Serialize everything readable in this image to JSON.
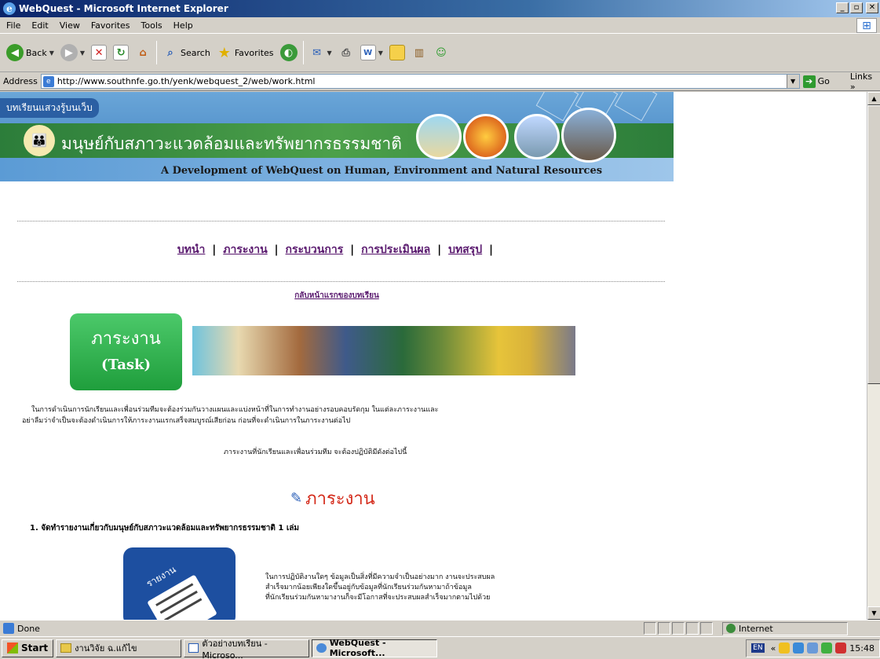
{
  "window": {
    "title": "WebQuest - Microsoft Internet Explorer",
    "buttons": [
      "_",
      "▫",
      "✕"
    ]
  },
  "menu": [
    "File",
    "Edit",
    "View",
    "Favorites",
    "Tools",
    "Help"
  ],
  "toolbar": {
    "back_label": "Back",
    "search_label": "Search",
    "favorites_label": "Favorites"
  },
  "address": {
    "label": "Address",
    "url": "http://www.southnfe.go.th/yenk/webquest_2/web/work.html",
    "go_label": "Go",
    "links_label": "Links »"
  },
  "banner": {
    "tagline": "บทเรียนแสวงรู้บนเว็บ",
    "thai_title": "มนุษย์กับสภาวะแวดล้อมและทรัพยากรธรรมชาติ",
    "english_title": "A Development of WebQuest on Human, Environment and Natural Resources"
  },
  "nav": {
    "links": [
      "บทนำ",
      "ภาระงาน",
      "กระบวนการ",
      "การประเมินผล",
      "บทสรุป"
    ],
    "separator": "|",
    "back_link": "กลับหน้าแรกของบทเรียน"
  },
  "task_box": {
    "thai": "ภาระงาน",
    "english": "(Task)"
  },
  "content": {
    "para1_line1": "ในการดำเนินการนักเรียนและเพื่อนร่วมทีมจะต้องร่วมกันวางแผนและแบ่งหน้าที่ในการทำงานอย่างรอบคอบรัดกุม ในแต่ละภาระงานและ",
    "para1_line2": "อย่าลืมว่าจำเป็นจะต้องดำเนินการให้ภาระงานแรกเสร็จสมบูรณ์เสียก่อน ก่อนที่จะดำเนินการในภาระงานต่อไป",
    "para2": "ภาระงานที่นักเรียนและเพื่อนร่วมทีม จะต้องปฏิบัติมีดังต่อไปนี้",
    "heading": "ภาระงาน",
    "item1": "1.  จัดทำรายงานเกี่ยวกับมนุษย์กับสภาวะแวดล้อมและทรัพยากรธรรมชาติ  1 เล่ม",
    "report_label": "รายงาน",
    "para3_line1": "ในการปฏิบัติงานใดๆ ข้อมูลเป็นสิ่งที่มีความจำเป็นอย่างมาก งานจะประสบผล",
    "para3_line2": "สำเร็จมากน้อยเพียงใดขึ้นอยู่กับข้อมูลที่นักเรียนร่วมกันหามาถ้าข้อมูล",
    "para3_line3": "ที่นักเรียนร่วมกันหามางานก็จะมีโอกาสที่จะประสบผลสำเร็จมากตามไปด้วย"
  },
  "status": {
    "left": "Done",
    "zone": "Internet"
  },
  "taskbar": {
    "start": "Start",
    "tasks": [
      "งานวิจัย ฉ.แก้ไข",
      "ตัวอย่างบทเรียน - Microso...",
      "WebQuest - Microsoft..."
    ],
    "lang": "EN",
    "clock": "15:48"
  },
  "colors": {
    "title_bar": "#0a246a",
    "link": "#5a1a6f",
    "task_green": "#2fb04c",
    "heading_red": "#d42a1a"
  }
}
